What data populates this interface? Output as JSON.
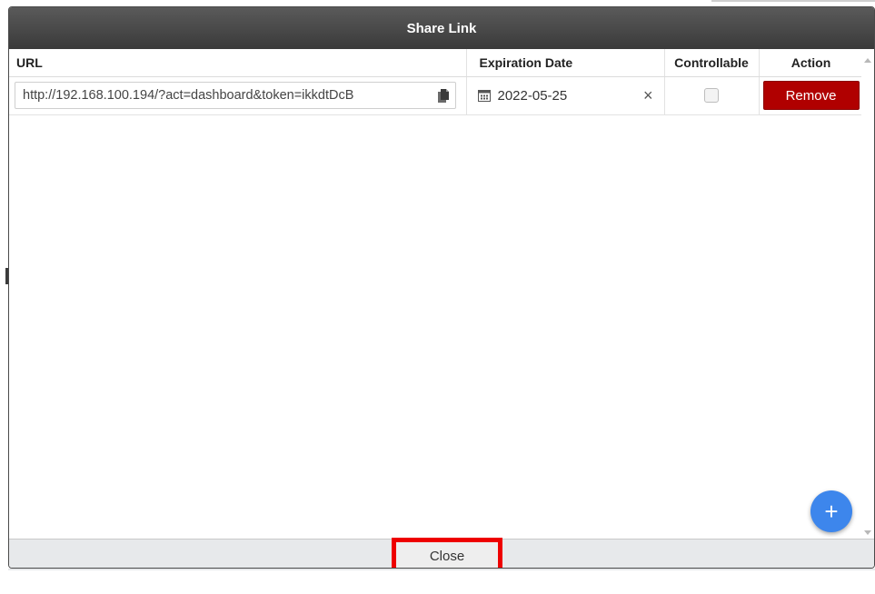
{
  "dialog": {
    "title": "Share Link",
    "columns": {
      "url": "URL",
      "expiration": "Expiration Date",
      "controllable": "Controllable",
      "action": "Action"
    },
    "rows": [
      {
        "url": "http://192.168.100.194/?act=dashboard&token=ikkdtDcB",
        "expiration": "2022-05-25",
        "controllable": false,
        "action_label": "Remove"
      }
    ],
    "clear_glyph": "×",
    "add_glyph": "+",
    "close_label": "Close"
  },
  "colors": {
    "remove_button": "#b00000",
    "add_button": "#3d86ec",
    "highlight_border": "#ee0000",
    "titlebar": "#4a4a4a"
  },
  "icons": [
    "copy-icon",
    "calendar-icon",
    "clear-icon",
    "plus-icon"
  ]
}
